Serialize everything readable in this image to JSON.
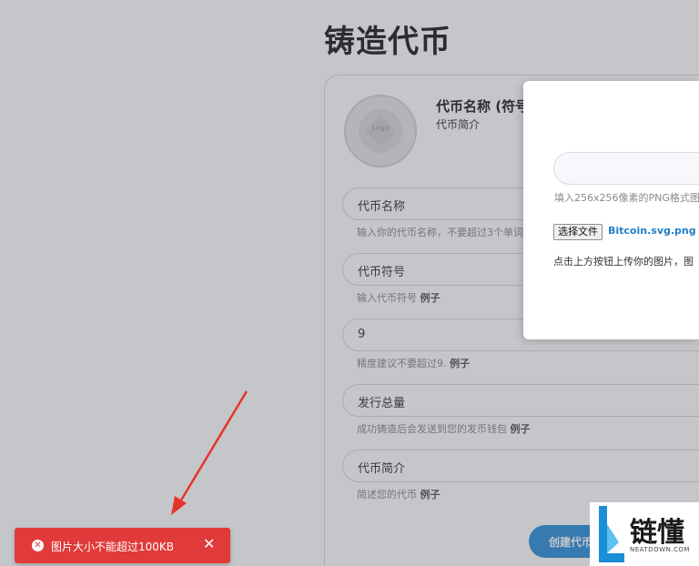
{
  "page": {
    "title": "铸造代币"
  },
  "token_preview": {
    "logo_text": "Logo",
    "heading": "代币名称 (符号)",
    "subtitle": "代币简介"
  },
  "fields": [
    {
      "value": "代币名称",
      "hint": "输入你的代币名称，不要超过3个单词",
      "example": ""
    },
    {
      "value": "代币符号",
      "hint": "输入代币符号 ",
      "example": "例子"
    },
    {
      "value": "9",
      "hint": "精度建议不要超过9. ",
      "example": "例子"
    },
    {
      "value": "发行总量",
      "hint": "成功铸造后会发送到您的发币钱包 ",
      "example": "例子"
    },
    {
      "value": "代币简介",
      "hint": "简述您的代币 ",
      "example": "例子"
    }
  ],
  "create_button": "创建代币",
  "modal": {
    "input_value": "",
    "input_hint": "填入256x256像素的PNG格式图",
    "file_button": "选择文件",
    "file_name": "Bitcoin.svg.png",
    "description": "点击上方按钮上传你的图片，图"
  },
  "toast": {
    "message": "图片大小不能超过100KB",
    "close": "✕",
    "icon": "✕",
    "color": "#e03a3a"
  },
  "watermark": {
    "text": "链懂",
    "sub": "NEATDOWN.COM"
  },
  "colors": {
    "accent": "#2f8fd8",
    "error": "#e03a3a",
    "arrow": "#e8332b"
  }
}
